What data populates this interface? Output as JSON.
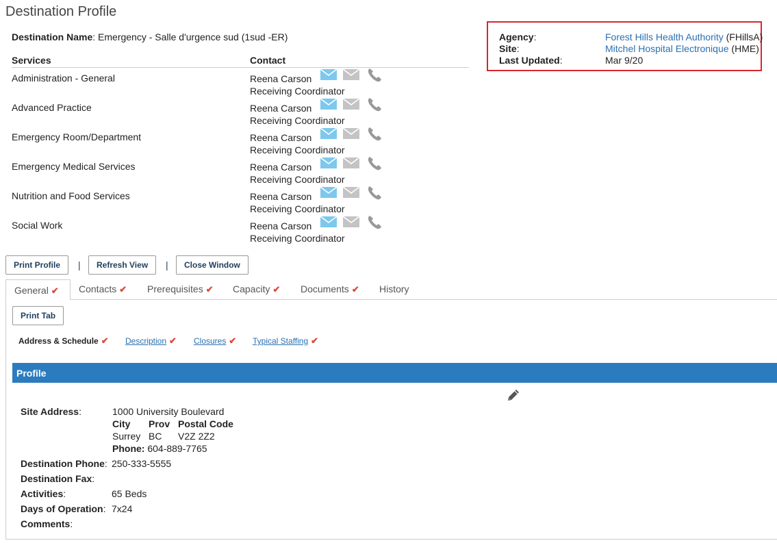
{
  "page": {
    "title": "Destination Profile"
  },
  "destination": {
    "name_label": "Destination Name",
    "name_value": ": Emergency - Salle d'urgence sud (1sud -ER)"
  },
  "services_table": {
    "headers": {
      "services": "Services",
      "contact": "Contact"
    },
    "rows": [
      {
        "service": "Administration - General",
        "contact_name": "Reena Carson",
        "contact_role": "Receiving Coordinator"
      },
      {
        "service": "Advanced Practice",
        "contact_name": "Reena Carson",
        "contact_role": "Receiving Coordinator"
      },
      {
        "service": "Emergency Room/Department",
        "contact_name": "Reena Carson",
        "contact_role": "Receiving Coordinator"
      },
      {
        "service": "Emergency Medical Services",
        "contact_name": "Reena Carson",
        "contact_role": "Receiving Coordinator"
      },
      {
        "service": "Nutrition and Food Services",
        "contact_name": "Reena Carson",
        "contact_role": "Receiving Coordinator"
      },
      {
        "service": "Social Work",
        "contact_name": "Reena Carson",
        "contact_role": "Receiving Coordinator"
      }
    ]
  },
  "info": {
    "agency_label": "Agency",
    "agency_link": "Forest Hills Health Authority",
    "agency_code": " (FHillsA)",
    "site_label": "Site",
    "site_link": "Mitchel Hospital Electronique",
    "site_code": " (HME)",
    "updated_label": "Last Updated",
    "updated_value": "Mar 9/20",
    "colon": ":"
  },
  "actions": {
    "print_profile": "Print Profile",
    "refresh_view": "Refresh View",
    "close_window": "Close Window",
    "separator": "|"
  },
  "tabs": [
    {
      "label": "General",
      "checked": true
    },
    {
      "label": "Contacts",
      "checked": true
    },
    {
      "label": "Prerequisites",
      "checked": true
    },
    {
      "label": "Capacity",
      "checked": true
    },
    {
      "label": "Documents",
      "checked": true
    },
    {
      "label": "History",
      "checked": false
    }
  ],
  "check_mark": "✔",
  "general": {
    "print_tab": "Print Tab",
    "subnav": [
      {
        "label": "Address & Schedule"
      },
      {
        "label": "Description"
      },
      {
        "label": "Closures"
      },
      {
        "label": "Typical Staffing"
      }
    ],
    "profile_title": "Profile",
    "site_address_label": "Site Address",
    "site_address": "1000 University Boulevard",
    "city_label": "City",
    "prov_label": "Prov",
    "postal_label": "Postal Code",
    "city": "Surrey",
    "prov": "BC",
    "postal": "V2Z 2Z2",
    "phone_label": "Phone:",
    "phone": " 604-889-7765",
    "dest_phone_label": "Destination Phone",
    "dest_phone": "250-333-5555",
    "dest_fax_label": "Destination Fax",
    "dest_fax": "",
    "activities_label": "Activities",
    "activities": "65 Beds",
    "days_label": "Days of Operation",
    "days": "7x24",
    "comments_label": "Comments",
    "comments": ""
  },
  "colors": {
    "accent": "#2b7bbf",
    "highlight_border": "#d9262e",
    "check": "#e0473b",
    "link": "#2a6fb0"
  }
}
